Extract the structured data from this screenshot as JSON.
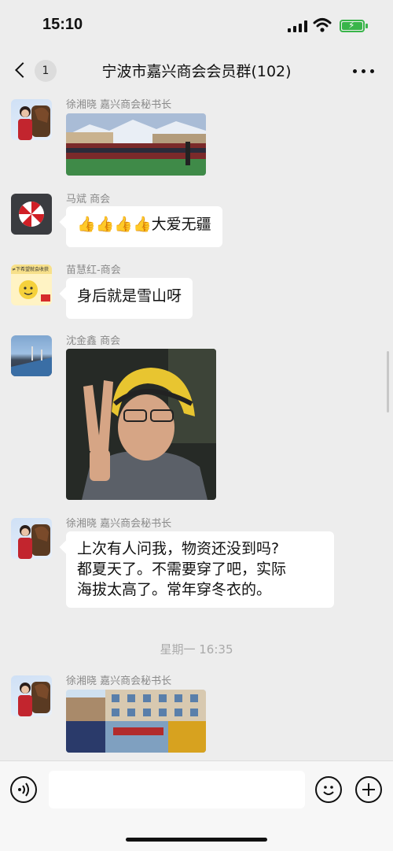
{
  "status_bar": {
    "time": "15:10"
  },
  "header": {
    "back_badge": "1",
    "title": "宁波市嘉兴商会会员群(102)"
  },
  "messages": [
    {
      "sender": "徐湘晓  嘉兴商会秘书长",
      "type": "image"
    },
    {
      "sender": "马斌  商会",
      "type": "text",
      "text": "👍👍👍👍大爱无疆"
    },
    {
      "sender": "苗慧红-商会",
      "type": "text",
      "text": "身后就是雪山呀"
    },
    {
      "sender": "沈金鑫  商会",
      "type": "image"
    },
    {
      "sender": "徐湘晓  嘉兴商会秘书长",
      "type": "text",
      "lines": [
        "上次有人问我，物资还没到吗?",
        "都夏天了。不需要穿了吧，实际",
        "海拔太高了。常年穿冬衣的。"
      ]
    },
    {
      "sender": "徐湘晓  嘉兴商会秘书长",
      "type": "image"
    }
  ],
  "timestamp": "星期一 16:35",
  "avatars": {
    "miao_badge_text": "≠下希望就会收获"
  },
  "colors": {
    "background": "#ededed",
    "bubble": "#ffffff",
    "battery": "#39b54a"
  }
}
